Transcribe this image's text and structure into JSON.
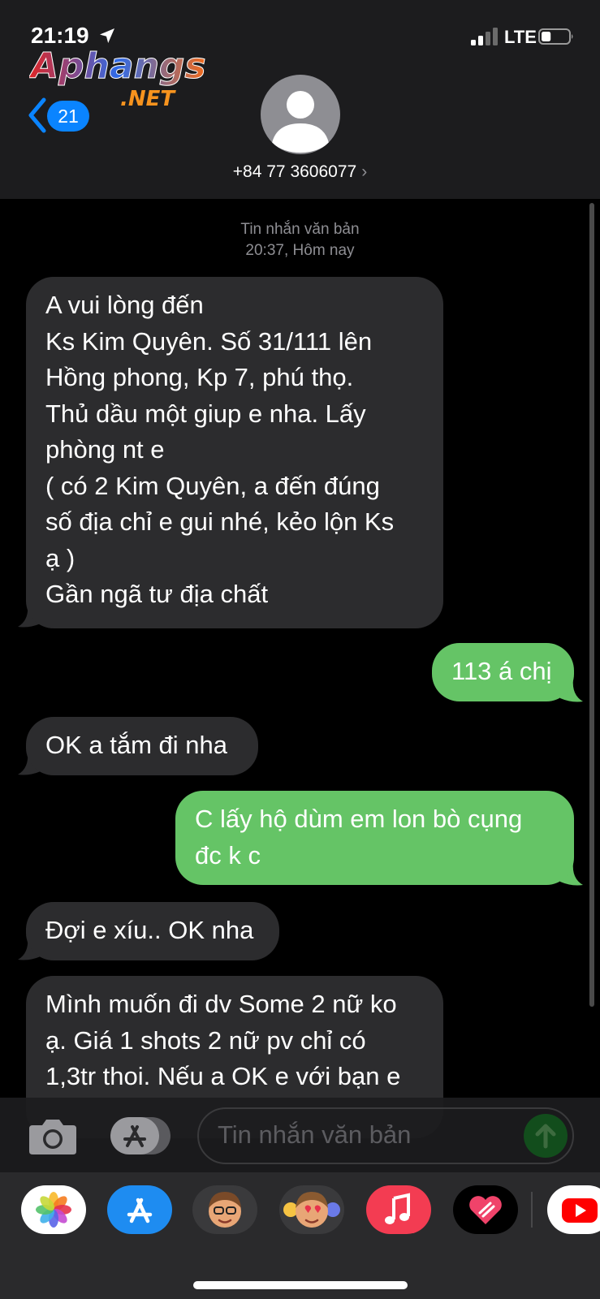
{
  "status_bar": {
    "time": "21:19",
    "network": "LTE",
    "battery_percent": 35
  },
  "watermark": {
    "brand": "Aphangs",
    "suffix": ".NET"
  },
  "nav": {
    "back_count": "21"
  },
  "contact": {
    "name": "+84 77 3606077",
    "chevron": "›"
  },
  "thread_meta": {
    "service": "Tin nhắn văn bản",
    "timestamp": "20:37, Hôm nay"
  },
  "messages": [
    {
      "direction": "incoming",
      "text": "A vui lòng đến\nKs Kim Quyên. Số 31/111 lên\nHồng phong, Kp 7, phú thọ.\nThủ dầu một giup e nha. Lấy\nphòng nt e\n( có 2 Kim Quyên, a đến đúng\nsố địa chỉ e gui nhé, kẻo lộn Ks\nạ )\nGần ngã tư địa chất"
    },
    {
      "direction": "outgoing",
      "text": "113 á chị"
    },
    {
      "direction": "incoming",
      "text": "OK a tắm đi nha"
    },
    {
      "direction": "outgoing",
      "text": "C lấy hộ dùm em lon bò cụng\nđc k c"
    },
    {
      "direction": "incoming",
      "text": "Đợi e xíu.. OK nha"
    },
    {
      "direction": "incoming",
      "text": "Mình muốn đi dv Some 2 nữ ko\nạ. Giá 1 shots 2 nữ pv chỉ có\n1,3tr thoi. Nếu a OK e với bạn e"
    }
  ],
  "composer": {
    "placeholder": "Tin nhắn văn bản"
  },
  "dock_apps": [
    {
      "name": "Photos",
      "icon": "photos-app-icon"
    },
    {
      "name": "App Store",
      "icon": "app-store-icon"
    },
    {
      "name": "Memoji",
      "icon": "memoji-icon"
    },
    {
      "name": "Memoji Stickers",
      "icon": "memoji-stickers-icon"
    },
    {
      "name": "Music",
      "icon": "music-app-icon"
    },
    {
      "name": "Digital Touch",
      "icon": "digital-touch-icon"
    },
    {
      "name": "YouTube",
      "icon": "youtube-app-icon"
    }
  ],
  "colors": {
    "incoming_bubble": "#2c2c2e",
    "outgoing_bubble": "#65c466",
    "accent": "#0a84ff"
  }
}
